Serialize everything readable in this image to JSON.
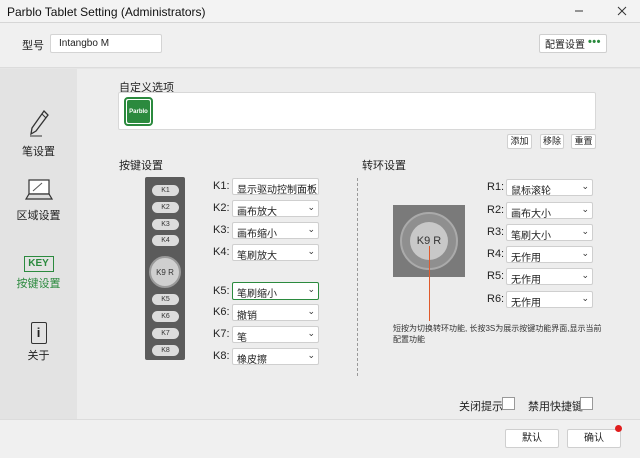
{
  "window": {
    "title": "Parblo Tablet Setting (Administrators)"
  },
  "header": {
    "model_label": "型号",
    "model_value": "Intangbo M",
    "config_label": "配置设置",
    "config_dots": "•••"
  },
  "sidebar": {
    "items": [
      {
        "label": "笔设置",
        "icon": "pen-icon",
        "active": false
      },
      {
        "label": "区域设置",
        "icon": "area-icon",
        "active": false
      },
      {
        "label": "按键设置",
        "icon": "key-icon",
        "icon_text": "KEY",
        "active": true
      },
      {
        "label": "关于",
        "icon": "info-icon",
        "icon_text": "i",
        "active": false
      }
    ]
  },
  "custom": {
    "title": "自定义选项",
    "app_icon_text": "Parblo",
    "add_label": "添加",
    "remove_label": "移除",
    "reset_label": "重置"
  },
  "keys": {
    "title": "按键设置",
    "tablet_keys": [
      "K1",
      "K2",
      "K3",
      "K4",
      "K5",
      "K6",
      "K7",
      "K8"
    ],
    "wheel_label": "K9 R",
    "rows": [
      {
        "label": "K1:",
        "value": "显示驱动控制面板"
      },
      {
        "label": "K2:",
        "value": "画布放大"
      },
      {
        "label": "K3:",
        "value": "画布缩小"
      },
      {
        "label": "K4:",
        "value": "笔刷放大"
      },
      {
        "label": "K5:",
        "value": "笔刷缩小"
      },
      {
        "label": "K6:",
        "value": "撤销"
      },
      {
        "label": "K7:",
        "value": "笔"
      },
      {
        "label": "K8:",
        "value": "橡皮擦"
      }
    ]
  },
  "ring": {
    "title": "转环设置",
    "wheel_label": "K9 R",
    "note": "短按为切换转环功能, 长按3S为展示按键功能界面,显示当前配置功能",
    "rows": [
      {
        "label": "R1:",
        "value": "鼠标滚轮"
      },
      {
        "label": "R2:",
        "value": "画布大小"
      },
      {
        "label": "R3:",
        "value": "笔刷大小"
      },
      {
        "label": "R4:",
        "value": "无作用"
      },
      {
        "label": "R5:",
        "value": "无作用"
      },
      {
        "label": "R6:",
        "value": "无作用"
      }
    ]
  },
  "options": {
    "close_tips": "关闭提示",
    "disable_shortcut": "禁用快捷键"
  },
  "footer": {
    "default_label": "默认",
    "confirm_label": "确认"
  },
  "colors": {
    "accent": "#2b8a3e",
    "pointer": "#e05a2b",
    "notify": "#e01e1e"
  }
}
